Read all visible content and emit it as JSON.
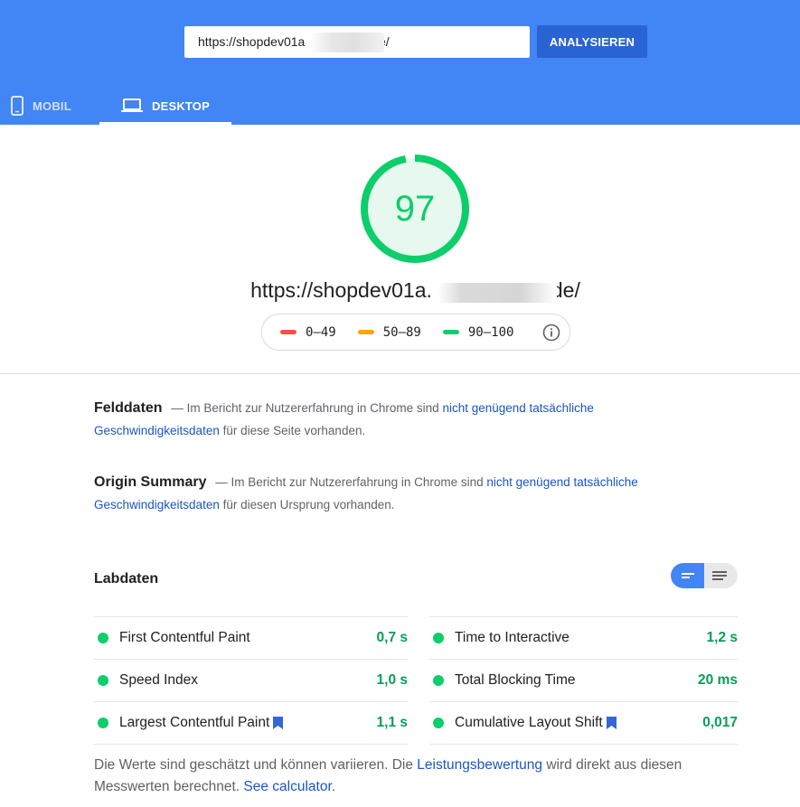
{
  "header": {
    "url_value": "https://shopdev01a                   de/",
    "analyze_label": "ANALYSIEREN",
    "tabs": [
      {
        "label": "MOBIL",
        "icon": "phone-icon",
        "active": false
      },
      {
        "label": "DESKTOP",
        "icon": "laptop-icon",
        "active": true
      }
    ]
  },
  "score": {
    "value": "97",
    "url_prefix": "https://shopdev01a.",
    "url_suffix": "de/"
  },
  "legend": {
    "items": [
      {
        "range": "0–49",
        "color": "#ff4e42"
      },
      {
        "range": "50–89",
        "color": "#ffa400"
      },
      {
        "range": "90–100",
        "color": "#0cce6b"
      }
    ]
  },
  "felddaten": {
    "title": "Felddaten",
    "text_before": "— Im Bericht zur Nutzererfahrung in Chrome sind",
    "link": "nicht genügend tatsächliche Geschwindigkeitsdaten",
    "text_after": "für diese Seite vorhanden."
  },
  "origin": {
    "title": "Origin Summary",
    "text_before": "— Im Bericht zur Nutzererfahrung in Chrome sind",
    "link": "nicht genügend tatsächliche Geschwindigkeitsdaten",
    "text_after": "für diesen Ursprung vorhanden."
  },
  "labdaten": {
    "title": "Labdaten",
    "left_metrics": [
      {
        "label": "First Contentful Paint",
        "value": "0,7 s",
        "bookmark": false
      },
      {
        "label": "Speed Index",
        "value": "1,0 s",
        "bookmark": false
      },
      {
        "label": "Largest Contentful Paint",
        "value": "1,1 s",
        "bookmark": true
      }
    ],
    "right_metrics": [
      {
        "label": "Time to Interactive",
        "value": "1,2 s",
        "bookmark": false
      },
      {
        "label": "Total Blocking Time",
        "value": "20 ms",
        "bookmark": false
      },
      {
        "label": "Cumulative Layout Shift",
        "value": "0,017",
        "bookmark": true
      }
    ]
  },
  "footnote": {
    "text1": "Die Werte sind geschätzt und können variieren. Die",
    "link1": "Leistungsbewertung",
    "text2": "wird direkt aus diesen Messwerten berechnet.",
    "link2": "See calculator",
    "text3": "."
  },
  "colors": {
    "header_bg": "#4285f4",
    "button_bg": "#2a63d4",
    "pass": "#0cce6b",
    "link": "#1a56c5"
  }
}
